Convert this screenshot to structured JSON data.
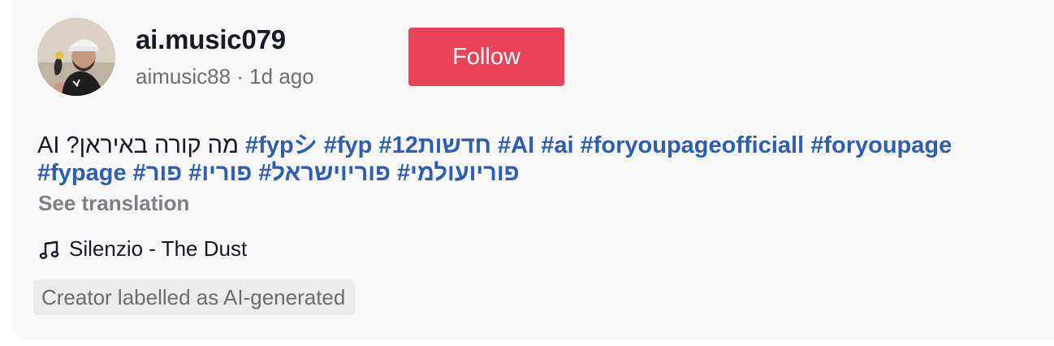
{
  "post_header": {
    "username": "ai.music079",
    "handle": "aimusic88",
    "separator": " · ",
    "time_ago": "1d ago",
    "follow_label": "Follow"
  },
  "caption": {
    "text": "מה קורה באיראן? AI",
    "hashtags": [
      "#fypシ",
      "#fyp",
      "#12חדשות",
      "#AI",
      "#ai",
      "#foryoupageofficiall",
      "#foryoupage",
      "#fypage",
      "#פור",
      "#פוריו",
      "#פוריוישראל",
      "#פוריועולמי"
    ]
  },
  "see_translation": "See translation",
  "music": {
    "icon": "music-note-icon",
    "title": "Silenzio - The Dust"
  },
  "ai_label": "Creator labelled as AI-generated",
  "colors": {
    "follow_button": "#ea4359",
    "hashtag": "#2b5db9",
    "card_background": "#f8f8f8"
  }
}
